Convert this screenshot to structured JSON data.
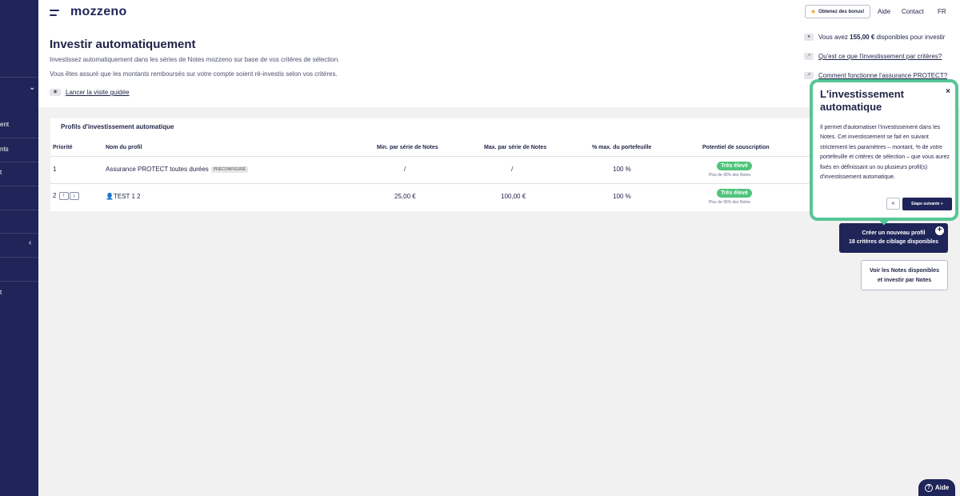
{
  "sidebar": {
    "items": [
      {
        "label": "ent"
      },
      {
        "label": "nts"
      },
      {
        "label": "t"
      },
      {
        "label": "t"
      }
    ]
  },
  "topbar": {
    "logo": "mozzeno",
    "bonus_label": "Obtenez des bonus!",
    "help_label": "Aide",
    "contact_label": "Contact",
    "lang_label": "FR"
  },
  "header": {
    "title": "Investir automatiquement",
    "description_1": "Investissez automatiquement dans les séries de Notes mozzeno sur base de vos critères de sélection.",
    "description_2": "Vous êtes assuré que les montants remboursés sur votre compte soient ré-investis selon vos critères.",
    "tour_link": "Lancer la visite guidée"
  },
  "info": {
    "available_prefix": "Vous avez",
    "available_amount": "155,00 €",
    "available_suffix": "disponibles pour investir",
    "link_criteria": "Qu'est ce que l'investissement par critères?",
    "link_protect": "Comment fonctionne l'assurance PROTECT?"
  },
  "profiles": {
    "title": "Profils d'investissement automatique",
    "columns": [
      "Priorité",
      "Nom du profil",
      "Min. par série de Notes",
      "Max. par série de Notes",
      "% max. du portefeuille",
      "Potentiel de souscription"
    ],
    "rows": [
      {
        "priority": "1",
        "name": "Assurance PROTECT toutes durées",
        "badge": "PRÉCONFIGURÉ",
        "min": "/",
        "max": "/",
        "pct": "100 %",
        "potential": "Très élevé",
        "potential_sub": "Plus de 95% des Notes"
      },
      {
        "priority": "2",
        "name": "TEST 1 2",
        "badge": "",
        "min": "25,00 €",
        "max": "100,00 €",
        "pct": "100 %",
        "potential": "Très élevé",
        "potential_sub": "Plus de 95% des Notes"
      }
    ]
  },
  "actions": {
    "create_line1": "Créer un nouveau profil",
    "create_line2": "18 critères de ciblage disponibles",
    "notes_line1": "Voir les Notes disponibles",
    "notes_line2": "et investir par Notes"
  },
  "popover": {
    "title": "L'investissement automatique",
    "body": "Il permet d'automatiser l'investissement dans les Notes. Cet investissement se fait en suivant strictement les paramètres – montant, % de votre portefeuille et critères de sélection – que vous aurez fixés en définissant un ou plusieurs profil(s) d'investissement automatique.",
    "prev_label": "«",
    "next_label": "Etape suivante »",
    "close_label": "×"
  },
  "help_widget": {
    "label": "Aide"
  },
  "colors": {
    "navy": "#1f2558",
    "green": "#4fc47a",
    "popover_border": "#56c596"
  }
}
